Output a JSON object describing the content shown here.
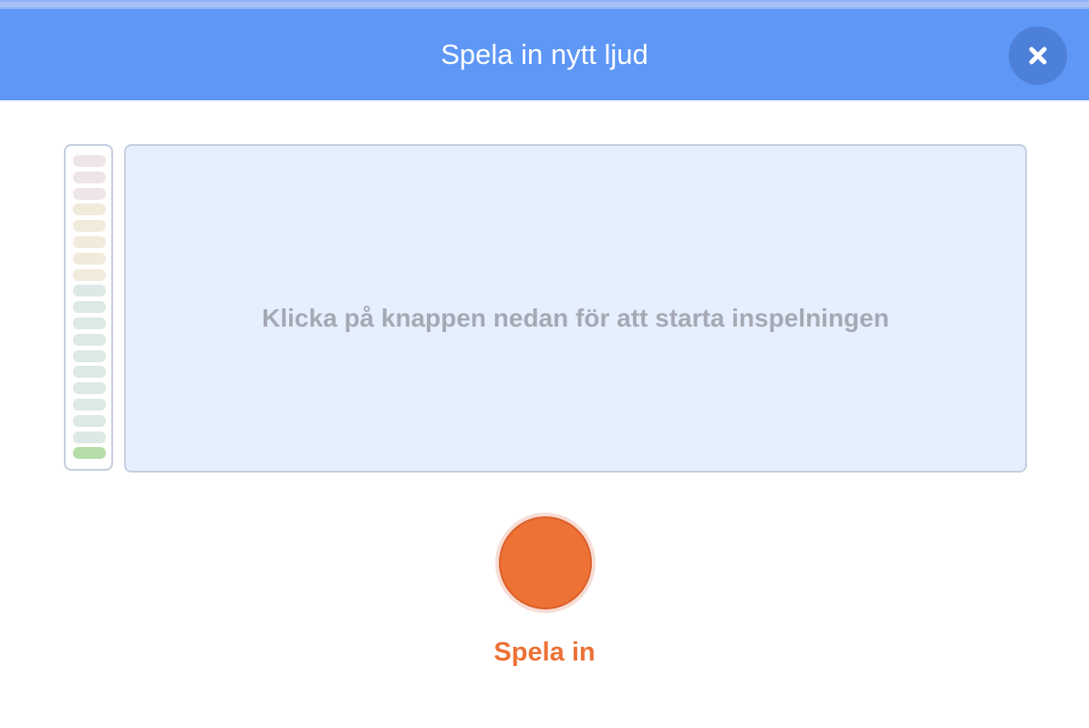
{
  "dialog": {
    "title": "Spela in nytt ljud",
    "close_icon": "close-icon",
    "accent_color": "#5e97f6"
  },
  "recorder": {
    "hint": "Klicka på knappen nedan för att starta inspelningen",
    "record_label": "Spela in",
    "record_color": "#ec7236",
    "level_meter": {
      "segments": 19,
      "active_segments": 1,
      "active_color": "#b6dca7",
      "segment_colors": [
        "#ede5e6",
        "#ede5e6",
        "#ede5e6",
        "#f1ebdc",
        "#f1ebdc",
        "#f1ebdc",
        "#f1ebdc",
        "#f1ebdc",
        "#dde9e5",
        "#dde9e5",
        "#dde9e5",
        "#dde9e5",
        "#dde9e5",
        "#dde9e5",
        "#dde9e5",
        "#dde9e5",
        "#dde9e5",
        "#dde9e5",
        "#b6dca7"
      ]
    }
  }
}
